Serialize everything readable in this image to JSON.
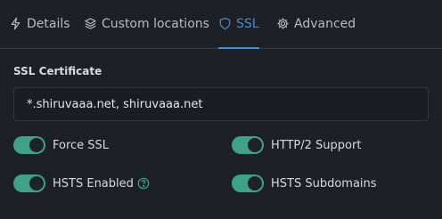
{
  "tabs": [
    {
      "label": "Details",
      "icon": "bolt-icon",
      "active": false
    },
    {
      "label": "Custom locations",
      "icon": "layers-icon",
      "active": false
    },
    {
      "label": "SSL",
      "icon": "shield-icon",
      "active": true
    },
    {
      "label": "Advanced",
      "icon": "gear-icon",
      "active": false
    }
  ],
  "ssl": {
    "section_label": "SSL Certificate",
    "certificate_value": "*.shiruvaaa.net, shiruvaaa.net",
    "options": [
      {
        "label": "Force SSL",
        "enabled": true
      },
      {
        "label": "HTTP/2 Support",
        "enabled": true
      },
      {
        "label": "HSTS Enabled",
        "enabled": true,
        "help_icon": "question-circle-icon"
      },
      {
        "label": "HSTS Subdomains",
        "enabled": true
      }
    ]
  },
  "colors": {
    "background": "#1d2024",
    "accent": "#4b8bd6",
    "toggle_on": "#3fa288"
  }
}
